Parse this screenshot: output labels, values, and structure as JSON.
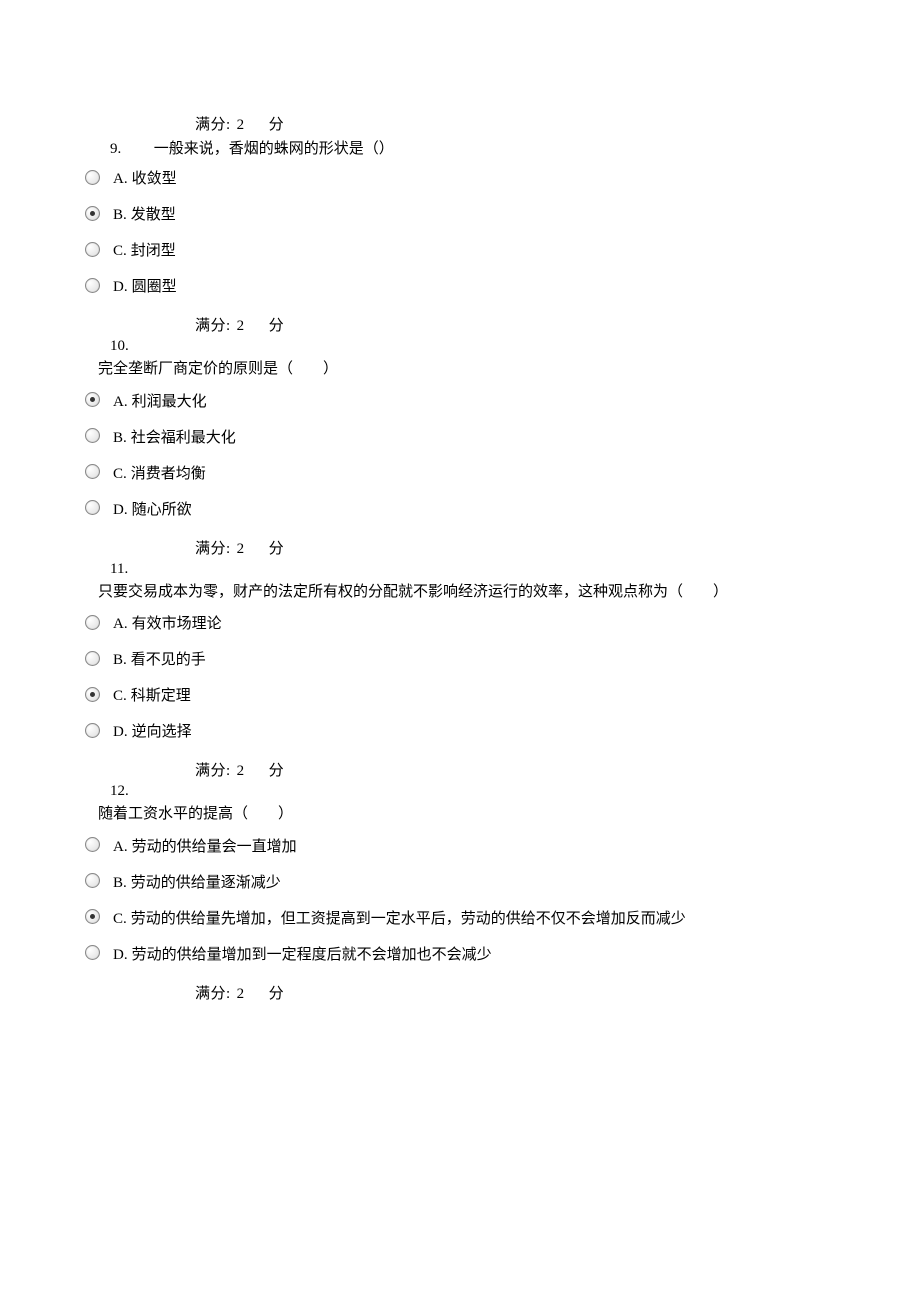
{
  "score": {
    "label": "满分:",
    "value": "2",
    "unit": "分"
  },
  "questions": [
    {
      "number": "9.",
      "text_inline": "一般来说，香烟的蛛网的形状是（）",
      "text_block": "",
      "options": [
        {
          "letter": "A.",
          "text": "收敛型",
          "selected": false
        },
        {
          "letter": "B.",
          "text": "发散型",
          "selected": true
        },
        {
          "letter": "C.",
          "text": "封闭型",
          "selected": false
        },
        {
          "letter": "D.",
          "text": "圆圈型",
          "selected": false
        }
      ]
    },
    {
      "number": "10.",
      "text_inline": "",
      "text_block": "完全垄断厂商定价的原则是（　　）",
      "options": [
        {
          "letter": "A.",
          "text": "利润最大化",
          "selected": true
        },
        {
          "letter": "B.",
          "text": "社会福利最大化",
          "selected": false
        },
        {
          "letter": "C.",
          "text": "消费者均衡",
          "selected": false
        },
        {
          "letter": "D.",
          "text": "随心所欲",
          "selected": false
        }
      ]
    },
    {
      "number": "11.",
      "text_inline": "",
      "text_block": "只要交易成本为零，财产的法定所有权的分配就不影响经济运行的效率，这种观点称为（　　）",
      "options": [
        {
          "letter": "A.",
          "text": "有效市场理论",
          "selected": false
        },
        {
          "letter": "B.",
          "text": "看不见的手",
          "selected": false
        },
        {
          "letter": "C.",
          "text": "科斯定理",
          "selected": true
        },
        {
          "letter": "D.",
          "text": "逆向选择",
          "selected": false
        }
      ]
    },
    {
      "number": "12.",
      "text_inline": "",
      "text_block": "随着工资水平的提高（　　）",
      "options": [
        {
          "letter": "A.",
          "text": "劳动的供给量会一直增加",
          "selected": false
        },
        {
          "letter": "B.",
          "text": "劳动的供给量逐渐减少",
          "selected": false
        },
        {
          "letter": "C.",
          "text": "劳动的供给量先增加，但工资提高到一定水平后，劳动的供给不仅不会增加反而减少",
          "selected": true
        },
        {
          "letter": "D.",
          "text": "劳动的供给量增加到一定程度后就不会增加也不会减少",
          "selected": false
        }
      ]
    }
  ]
}
